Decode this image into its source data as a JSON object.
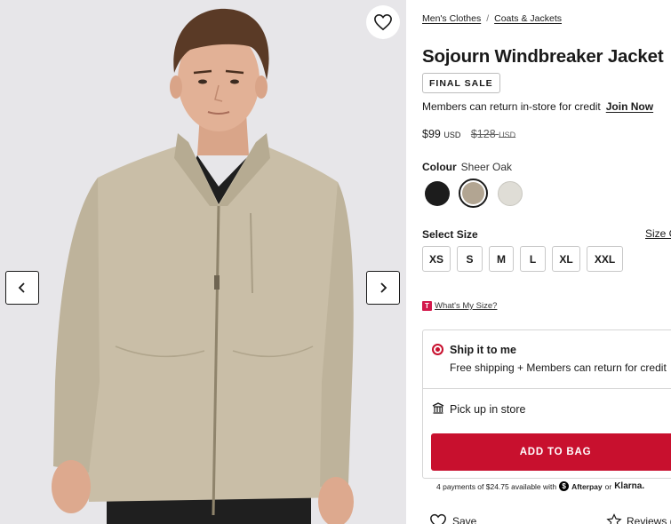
{
  "gallery": {
    "favorite_icon": "heart-outline-icon",
    "prev_icon": "chevron-left-icon",
    "next_icon": "chevron-right-icon"
  },
  "breadcrumb": {
    "items": [
      "Men's Clothes",
      "Coats & Jackets"
    ],
    "separator": "/"
  },
  "product": {
    "title": "Sojourn Windbreaker Jacket",
    "badge": "FINAL SALE",
    "returns_text": "Members can return in-store for credit",
    "join_link": "Join Now",
    "price": "$99",
    "price_currency": "USD",
    "original_price": "$128",
    "original_currency": "USD"
  },
  "colour": {
    "label": "Colour",
    "selected_name": "Sheer Oak",
    "swatches": [
      {
        "color": "#1c1c1c",
        "selected": false
      },
      {
        "color": "#b2a592",
        "selected": true
      },
      {
        "color": "#dfddd6",
        "selected": false
      }
    ]
  },
  "size": {
    "label": "Select Size",
    "guide_link": "Size G",
    "options": [
      "XS",
      "S",
      "M",
      "L",
      "XL",
      "XXL"
    ],
    "fit_help_tag": "T",
    "fit_help_link": "What's My Size?"
  },
  "delivery": {
    "ship_title": "Ship it to me",
    "ship_sub": "Free shipping + Members can return for credit",
    "pickup_label": "Pick up in store"
  },
  "cart": {
    "add_label": "ADD TO BAG",
    "installments_text": "4 payments of $24.75 available with",
    "afterpay_label": "Afterpay",
    "or_text": "or",
    "klarna_label": "Klarna."
  },
  "actions": {
    "save_label": "Save",
    "reviews_label": "Reviews ("
  },
  "colors": {
    "accent_red": "#c8102e",
    "jacket": "#c9bea7",
    "background": "#e7e6e9"
  }
}
